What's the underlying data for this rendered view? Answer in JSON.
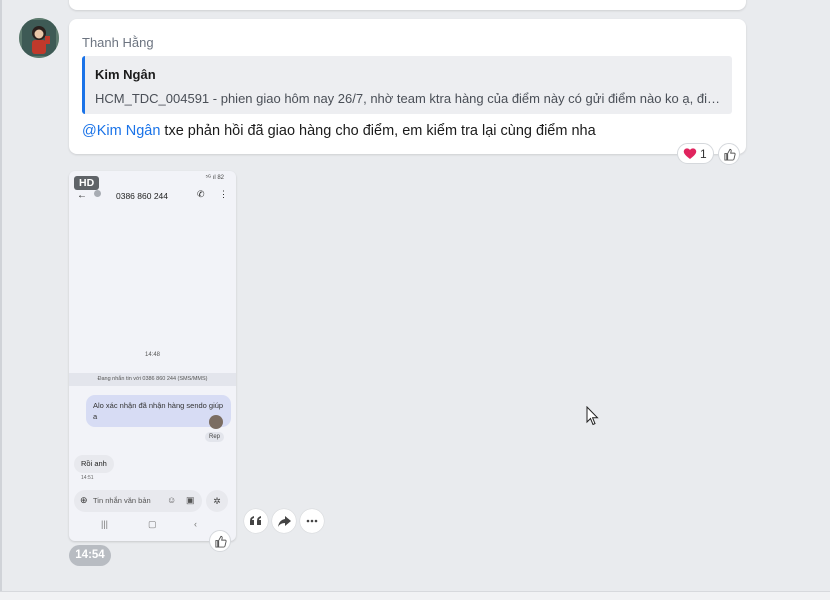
{
  "message": {
    "sender_name": "Thanh Hằng",
    "quote": {
      "author": "Kim Ngân",
      "text": "HCM_TDC_004591 - phien giao hôm nay 26/7, nhờ team ktra hàng của điểm này có gửi điểm nào ko ạ, điể..."
    },
    "mention": "@Kim Ngân",
    "body": " txe phản hồi đã giao hàng cho điểm, em kiểm tra lại cùng điểm nha",
    "reaction_count": "1"
  },
  "image_message": {
    "hd_badge": "HD",
    "phone": {
      "status": "⁵ᴳ ıl 82",
      "number": "0386 860 244",
      "time": "14:48",
      "notice": "Đang nhắn tin với 0386 860 244 (SMS/MMS)",
      "outgoing_text": "Alo xác nhận đã nhận hàng sendo giúp a",
      "reply_label": "Rep",
      "incoming_text": "Rồi anh",
      "incoming_time": "14:51",
      "input_placeholder": "Tin nhắn văn bản"
    },
    "time": "14:54"
  },
  "icons": {
    "reaction": "heart-icon",
    "like": "thumbs-up-icon",
    "quote_action": "quote-icon",
    "share_action": "share-icon",
    "more_action": "more-icon"
  },
  "colors": {
    "mention": "#1a73e8",
    "quote_bar": "#1a73e8",
    "heart": "#e0245e"
  }
}
